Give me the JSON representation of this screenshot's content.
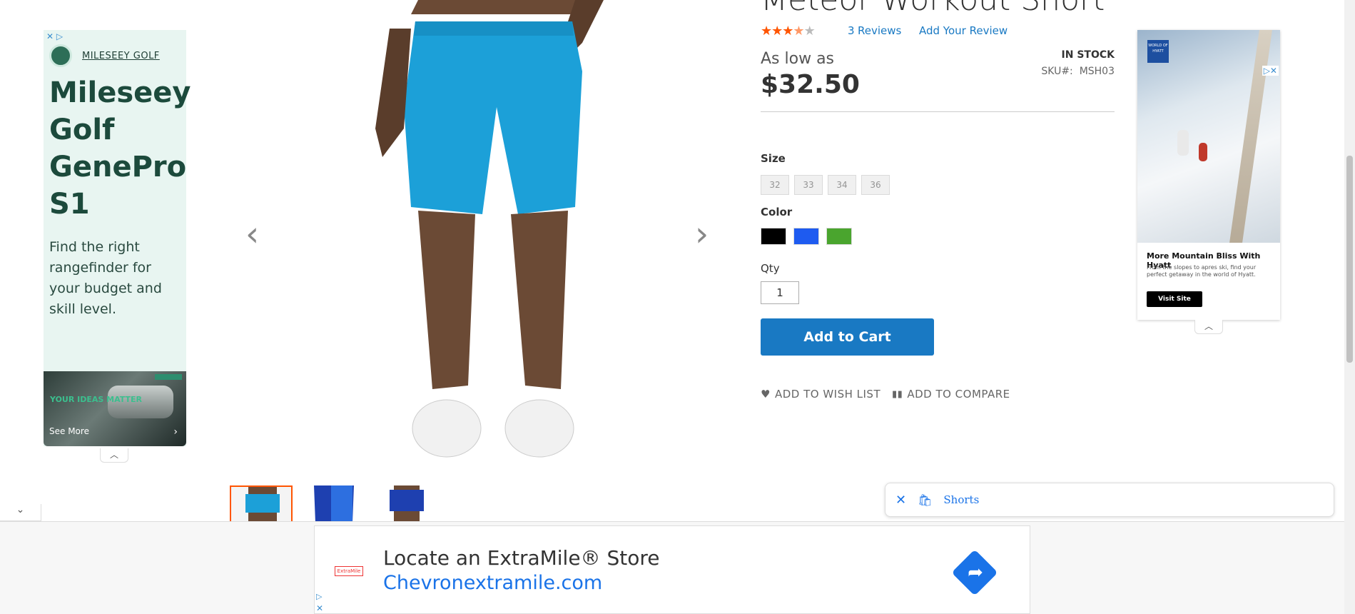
{
  "product": {
    "title": "Meteor Workout Short",
    "rating_stars_on": "★★★",
    "rating_stars_half": "★",
    "rating_stars_off": "★",
    "reviews_count": "3",
    "reviews_label": "Reviews",
    "add_review": "Add Your Review",
    "as_low_as": "As low as",
    "price": "$32.50",
    "stock": "IN STOCK",
    "sku_label": "SKU#:",
    "sku": "MSH03",
    "size_label": "Size",
    "sizes": [
      "32",
      "33",
      "34",
      "36"
    ],
    "color_label": "Color",
    "colors": [
      "#000000",
      "#1e5bf0",
      "#4aa52e"
    ],
    "qty_label": "Qty",
    "qty": "1",
    "add_to_cart": "Add to Cart",
    "wish_list": "ADD TO WISH LIST",
    "compare": "ADD TO COMPARE"
  },
  "gallery": {
    "prev_icon": "‹",
    "next_icon": "›"
  },
  "left_ad": {
    "brand": "MILESEEY GOLF",
    "headline": "Mileseey Golf GenePro S1",
    "sub": "Find the right rangefinder for your budget and skill level.",
    "photo_text": "YOUR IDEAS MATTER",
    "see_more": "See More"
  },
  "right_ad": {
    "badge": "WORLD OF HYATT",
    "headline": "More Mountain Bliss With Hyatt",
    "body": "From the slopes to apres ski, find your perfect getaway in the world of Hyatt.",
    "cta": "Visit Site"
  },
  "chip": {
    "label": "Shorts"
  },
  "bottom_ad": {
    "line1": "Locate an ExtraMile® Store",
    "line2": "Chevronextramile.com",
    "logo": "ExtraMile"
  }
}
